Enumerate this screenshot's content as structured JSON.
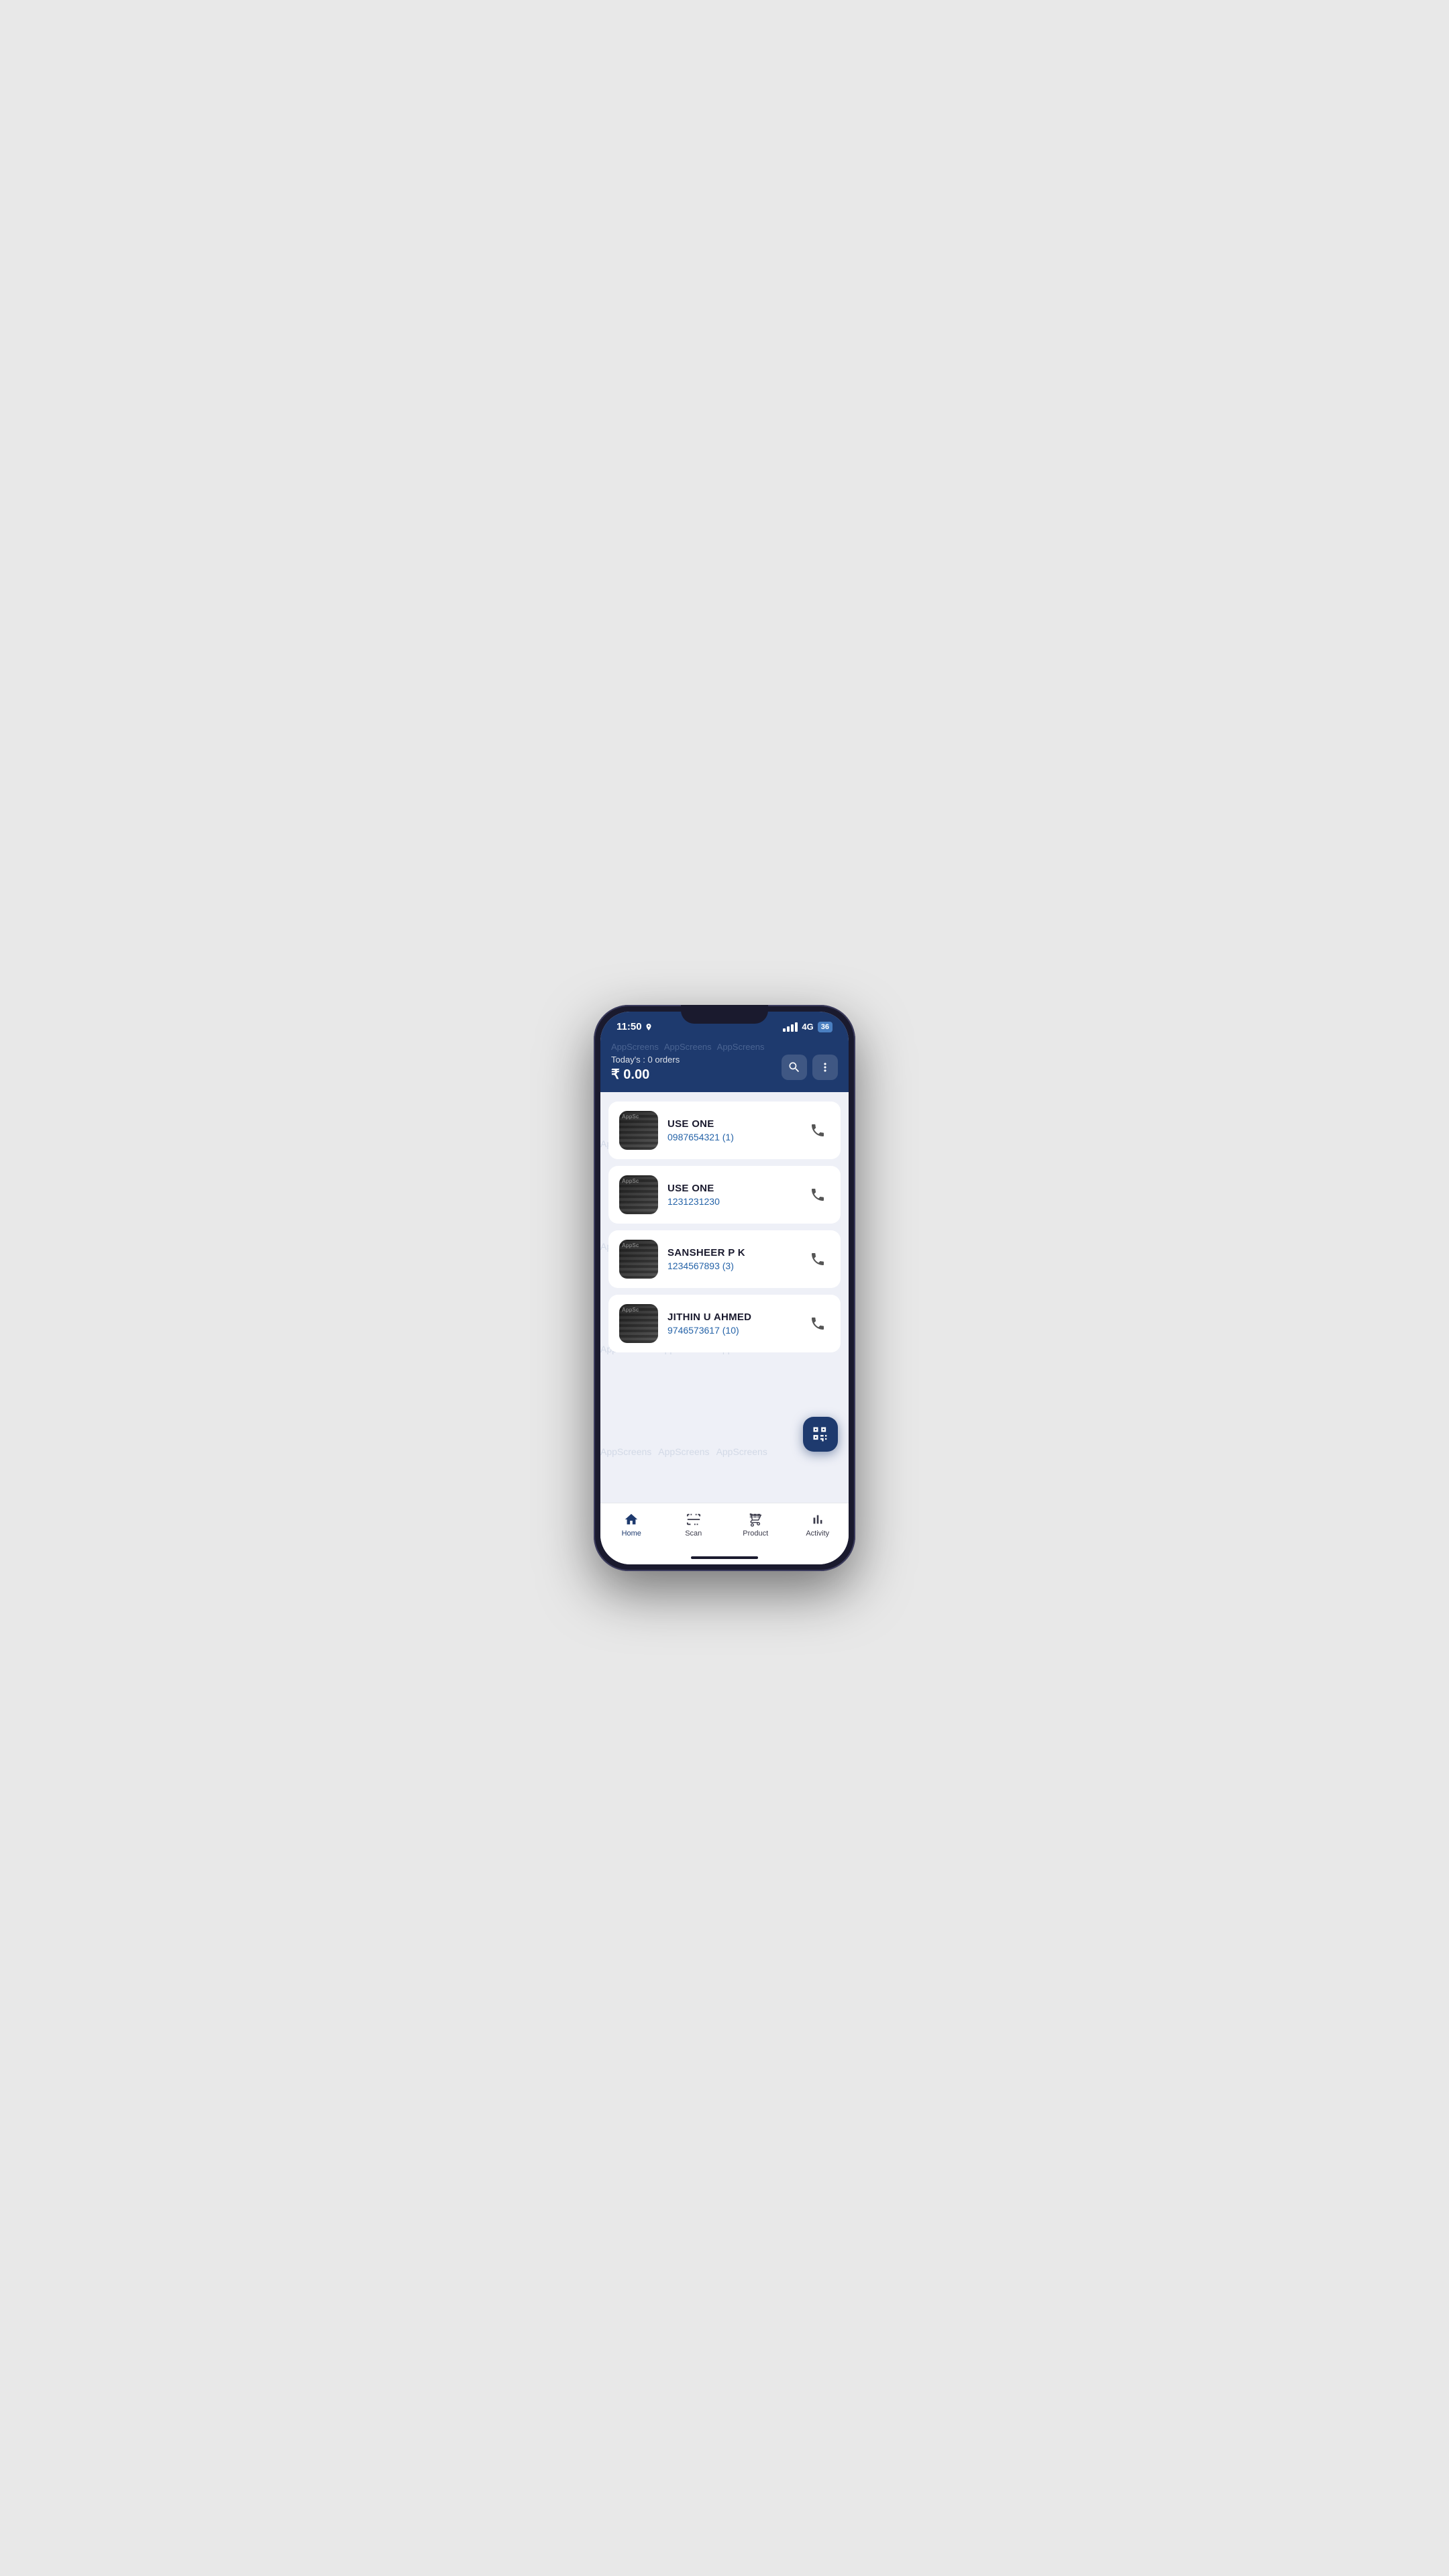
{
  "status_bar": {
    "time": "11:50",
    "network": "4G",
    "battery": "36"
  },
  "header": {
    "watermarks": [
      "AppScreens",
      "AppScreens",
      "AppScreens"
    ],
    "todays_label": "Today's : 0 orders",
    "amount": "₹ 0.00",
    "search_tooltip": "Search",
    "more_tooltip": "More options"
  },
  "customers": [
    {
      "name": "USE ONE",
      "phone": "0987654321 (1)"
    },
    {
      "name": "USE ONE",
      "phone": "1231231230"
    },
    {
      "name": "SANSHEER P K",
      "phone": "1234567893 (3)"
    },
    {
      "name": "JITHIN U AHMED",
      "phone": "9746573617 (10)"
    }
  ],
  "bottom_nav": [
    {
      "id": "home",
      "label": "Home",
      "active": true
    },
    {
      "id": "scan",
      "label": "Scan",
      "active": false
    },
    {
      "id": "product",
      "label": "Product",
      "active": false
    },
    {
      "id": "activity",
      "label": "Activity",
      "active": false
    }
  ],
  "watermark_text": "AppScreens"
}
